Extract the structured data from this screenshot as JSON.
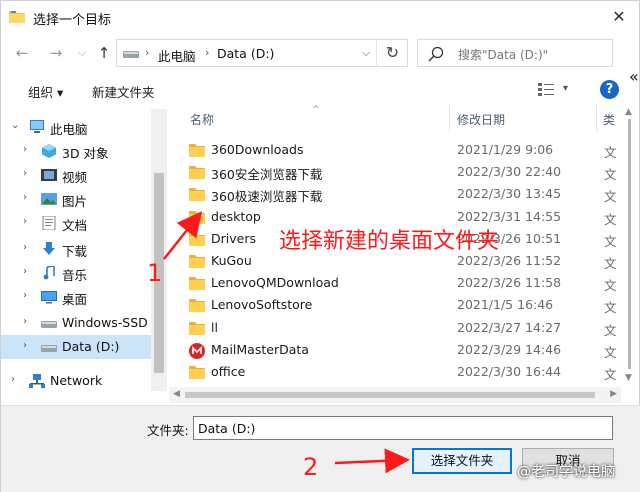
{
  "window": {
    "title": "选择一个目标",
    "close_glyph": "✕"
  },
  "nav": {
    "back": "←",
    "forward": "→",
    "recent": "⌵",
    "up": "↑",
    "address": {
      "sep1": "›",
      "crumb1": "此电脑",
      "sep2": "›",
      "crumb2": "Data (D:)",
      "dropdown": "⌵"
    },
    "refresh": "↻",
    "search_placeholder": "搜索\"Data (D:)\""
  },
  "toolbar": {
    "organize": "组织 ▾",
    "new_folder": "新建文件夹",
    "view_dropdown": "▾",
    "help": "?"
  },
  "tree": [
    {
      "label": "此电脑",
      "chevron": "⌄",
      "icon": "computer-icon",
      "indent": 0
    },
    {
      "label": "3D 对象",
      "chevron": "›",
      "icon": "3d-objects-icon",
      "indent": 1
    },
    {
      "label": "视频",
      "chevron": "›",
      "icon": "videos-icon",
      "indent": 1
    },
    {
      "label": "图片",
      "chevron": "›",
      "icon": "pictures-icon",
      "indent": 1
    },
    {
      "label": "文档",
      "chevron": "›",
      "icon": "documents-icon",
      "indent": 1
    },
    {
      "label": "下载",
      "chevron": "›",
      "icon": "downloads-icon",
      "indent": 1
    },
    {
      "label": "音乐",
      "chevron": "›",
      "icon": "music-icon",
      "indent": 1
    },
    {
      "label": "桌面",
      "chevron": "›",
      "icon": "desktop-icon",
      "indent": 1
    },
    {
      "label": "Windows-SSD (",
      "chevron": "›",
      "icon": "drive-icon",
      "indent": 1
    },
    {
      "label": "Data (D:)",
      "chevron": "›",
      "icon": "drive-icon",
      "indent": 1,
      "selected": true
    },
    {
      "label": "Network",
      "chevron": "›",
      "icon": "network-icon",
      "indent": 0
    }
  ],
  "columns": {
    "name": "名称",
    "date": "修改日期",
    "type": "类",
    "sort": "^"
  },
  "files": [
    {
      "name": "360Downloads",
      "date": "2021/1/29 9:06",
      "type": "文",
      "icon": "folder-icon"
    },
    {
      "name": "360安全浏览器下载",
      "date": "2022/3/30 22:40",
      "type": "文",
      "icon": "folder-icon"
    },
    {
      "name": "360极速浏览器下载",
      "date": "2022/3/30 13:45",
      "type": "文",
      "icon": "folder-icon"
    },
    {
      "name": "desktop",
      "date": "2022/3/31 14:55",
      "type": "文",
      "icon": "folder-icon"
    },
    {
      "name": "Drivers",
      "date": "2022/3/26 10:51",
      "type": "文",
      "icon": "folder-icon"
    },
    {
      "name": "KuGou",
      "date": "2022/3/26 11:52",
      "type": "文",
      "icon": "folder-icon"
    },
    {
      "name": "LenovoQMDownload",
      "date": "2022/3/26 11:58",
      "type": "文",
      "icon": "folder-icon"
    },
    {
      "name": "LenovoSoftstore",
      "date": "2021/1/5 16:46",
      "type": "文",
      "icon": "folder-icon"
    },
    {
      "name": "ll",
      "date": "2022/3/27 14:27",
      "type": "文",
      "icon": "folder-icon"
    },
    {
      "name": "MailMasterData",
      "date": "2022/3/29 14:46",
      "type": "文",
      "icon": "mailmaster-icon"
    },
    {
      "name": "office",
      "date": "2022/3/30 16:44",
      "type": "文",
      "icon": "folder-icon"
    }
  ],
  "bottom": {
    "folder_label": "文件夹:",
    "folder_value": "Data (D:)",
    "select_button": "选择文件夹",
    "cancel_button": "取消"
  },
  "annotations": {
    "instruction": "选择新建的桌面文件夹",
    "step1": "1",
    "step2": "2",
    "watermark": "@老司学说电脑",
    "color": "#ff1a1a"
  },
  "edge_glyph": "«"
}
